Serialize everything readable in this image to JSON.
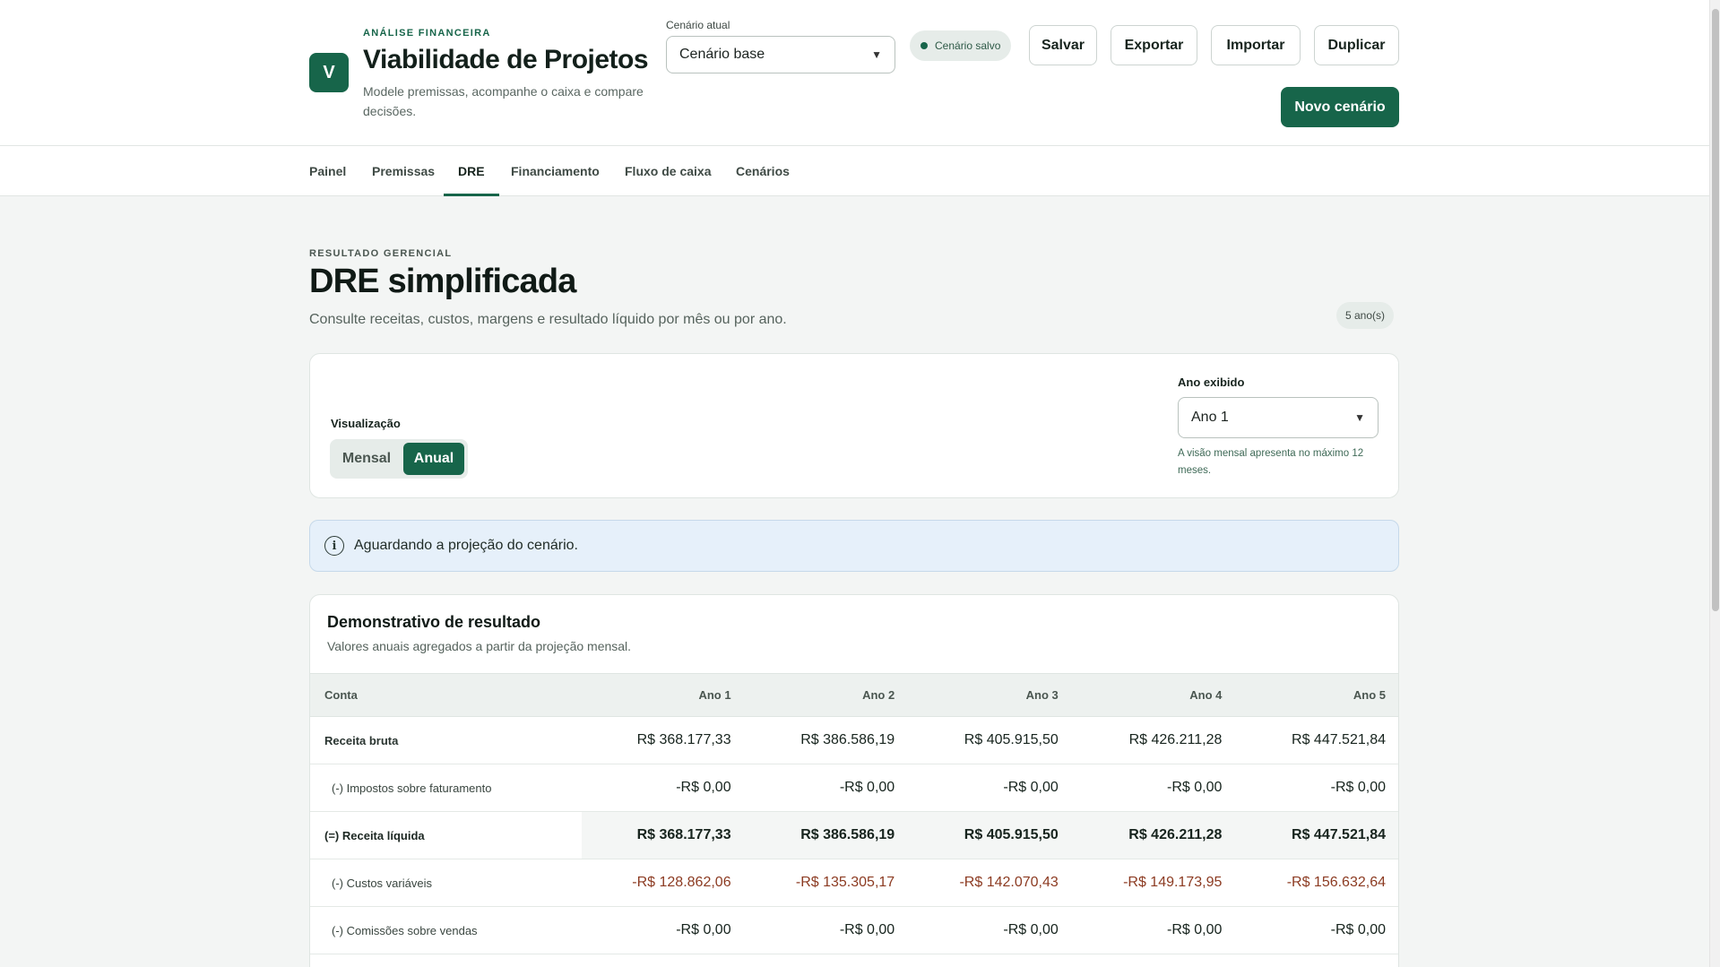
{
  "header": {
    "logo_letter": "V",
    "eyebrow": "ANÁLISE FINANCEIRA",
    "title": "Viabilidade de Projetos",
    "subtitle": "Modele premissas, acompanhe o caixa e compare decisões.",
    "scenario_label": "Cenário atual",
    "scenario_value": "Cenário base",
    "saved_status": "Cenário salvo",
    "buttons": {
      "save": "Salvar",
      "export": "Exportar",
      "import": "Importar",
      "duplicate": "Duplicar",
      "new_scenario": "Novo cenário"
    }
  },
  "nav": {
    "tabs": [
      "Painel",
      "Premissas",
      "DRE",
      "Financiamento",
      "Fluxo de caixa",
      "Cenários"
    ],
    "active": "DRE"
  },
  "page": {
    "eyebrow": "RESULTADO GERENCIAL",
    "title": "DRE simplificada",
    "subtitle": "Consulte receitas, custos, margens e resultado líquido por mês ou por ano.",
    "years_badge": "5 ano(s)"
  },
  "controls": {
    "view_label": "Visualização",
    "view_options": [
      "Mensal",
      "Anual"
    ],
    "view_selected": "Anual",
    "year_label": "Ano exibido",
    "year_value": "Ano 1",
    "year_help": "A visão mensal apresenta no máximo 12 meses."
  },
  "alert": {
    "icon": "info-icon",
    "text": "Aguardando a projeção do cenário."
  },
  "table": {
    "title": "Demonstrativo de resultado",
    "subtitle": "Valores anuais agregados a partir da projeção mensal.",
    "columns": [
      "Conta",
      "Ano 1",
      "Ano 2",
      "Ano 3",
      "Ano 4",
      "Ano 5"
    ],
    "rows": [
      {
        "label": "Receita bruta",
        "values": [
          "R$ 368.177,33",
          "R$ 386.586,19",
          "R$ 405.915,50",
          "R$ 426.211,28",
          "R$ 447.521,84"
        ]
      },
      {
        "label": "(-) Impostos sobre faturamento",
        "values": [
          "-R$ 0,00",
          "-R$ 0,00",
          "-R$ 0,00",
          "-R$ 0,00",
          "-R$ 0,00"
        ]
      },
      {
        "label": "(=) Receita líquida",
        "values": [
          "R$ 368.177,33",
          "R$ 386.586,19",
          "R$ 405.915,50",
          "R$ 426.211,28",
          "R$ 447.521,84"
        ]
      },
      {
        "label": "(-) Custos variáveis",
        "values": [
          "-R$ 128.862,06",
          "-R$ 135.305,17",
          "-R$ 142.070,43",
          "-R$ 149.173,95",
          "-R$ 156.632,64"
        ]
      },
      {
        "label": "(-) Comissões sobre vendas",
        "values": [
          "-R$ 0,00",
          "-R$ 0,00",
          "-R$ 0,00",
          "-R$ 0,00",
          "-R$ 0,00"
        ]
      }
    ]
  },
  "colors": {
    "brand": "#17654a",
    "negative": "#8c3b22",
    "alert_bg": "#e6f0fa"
  }
}
